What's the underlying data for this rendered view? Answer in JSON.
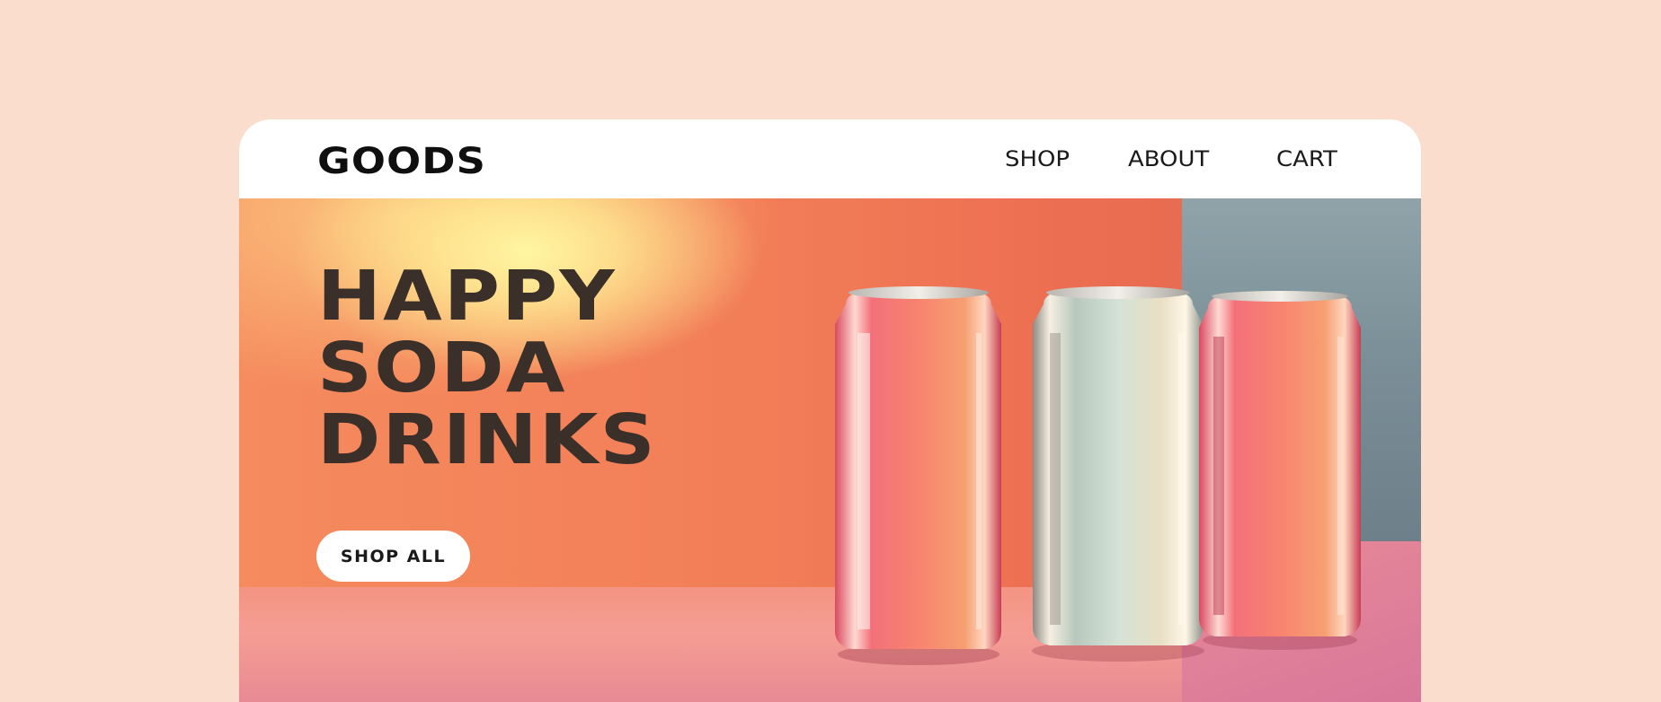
{
  "nav": {
    "logo": "GOODS",
    "links": [
      "SHOP",
      "ABOUT",
      "CART"
    ]
  },
  "hero": {
    "headline": [
      "HAPPY",
      "SODA",
      "DRINKS"
    ],
    "cta_label": "SHOP ALL",
    "image": "three-soda-cans"
  },
  "colors": {
    "page_background": "#fbddcd",
    "headline": "#3a2f29",
    "hero_orange": "#f4825a",
    "can_pink": "#f06c78",
    "can_silver": "#c8d6cc"
  }
}
